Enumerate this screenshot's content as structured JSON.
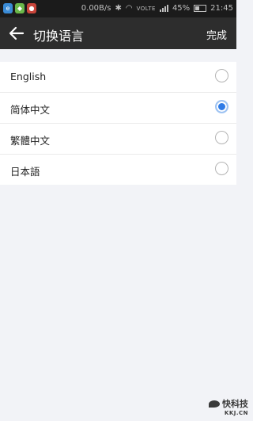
{
  "status_bar": {
    "speed": "0.00B/s",
    "network": "VOLTE",
    "battery": "45%",
    "time": "21:45"
  },
  "header": {
    "title": "切换语言",
    "done_label": "完成"
  },
  "languages": [
    {
      "label": "English",
      "selected": false
    },
    {
      "label": "简体中文",
      "selected": true
    },
    {
      "label": "繁體中文",
      "selected": false
    },
    {
      "label": "日本語",
      "selected": false
    }
  ],
  "watermark": {
    "main": "快科技",
    "sub": "KKJ.CN"
  },
  "colors": {
    "status_bar_bg": "#1b1b1b",
    "title_bar_bg": "#2d2d2d",
    "page_bg": "#f2f3f7",
    "radio_selected": "#2f7be6"
  }
}
